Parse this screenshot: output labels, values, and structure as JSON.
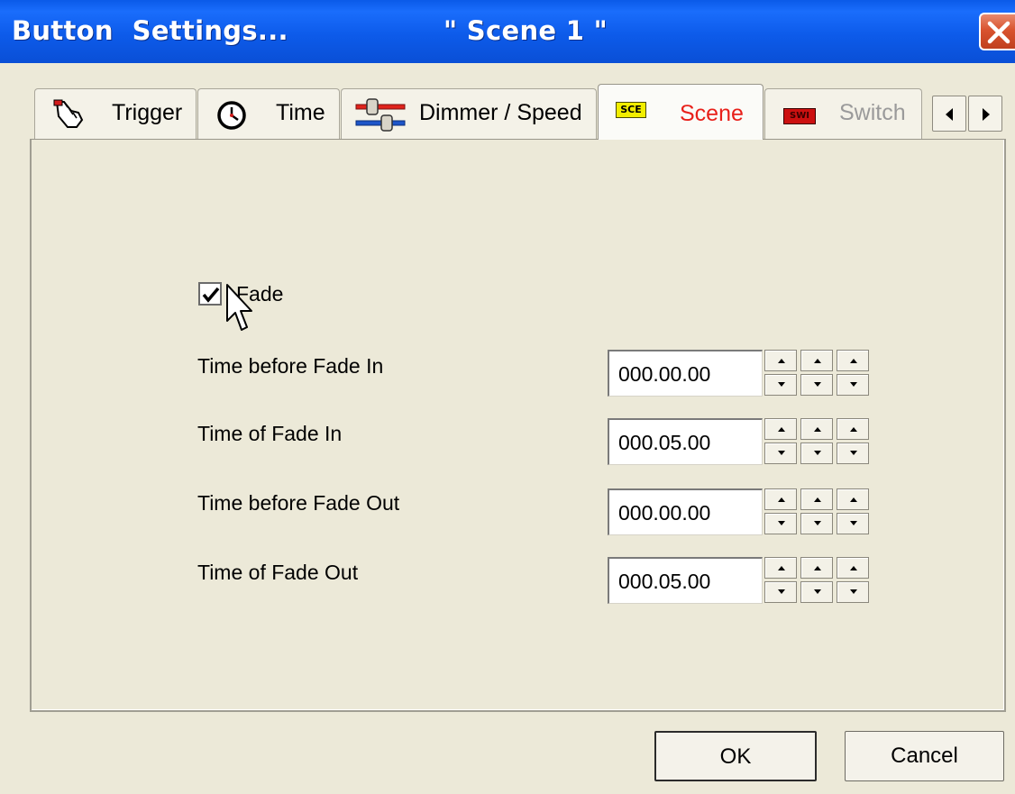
{
  "window": {
    "title": "Button  Settings...",
    "subtitle": "\" Scene 1 \""
  },
  "tabs": [
    {
      "label": "Trigger",
      "icon": "hand-pointer-icon",
      "active": false
    },
    {
      "label": "Time",
      "icon": "clock-icon",
      "active": false
    },
    {
      "label": "Dimmer / Speed",
      "icon": "slider-icon",
      "active": false
    },
    {
      "label": "Scene",
      "icon": "scene-icon",
      "icon_text": "SCE",
      "active": true
    },
    {
      "label": "Switch",
      "icon": "switch-icon",
      "icon_text": "SWI",
      "active": false
    }
  ],
  "scene": {
    "fade_label": "Fade",
    "fade_checked": true,
    "rows": [
      {
        "label": "Time before Fade In",
        "value": "000.00.00"
      },
      {
        "label": "Time of Fade In",
        "value": "000.05.00"
      },
      {
        "label": "Time before Fade Out",
        "value": "000.00.00"
      },
      {
        "label": "Time of Fade Out",
        "value": "000.05.00"
      }
    ]
  },
  "buttons": {
    "ok": "OK",
    "cancel": "Cancel"
  },
  "colors": {
    "titlebar": "#0a5ae8",
    "active_tab_label": "#e8201a",
    "disabled_tab_label": "#9a9a9a",
    "scene_icon_bg": "#f2ee00",
    "switch_icon_bg": "#cc1010"
  }
}
